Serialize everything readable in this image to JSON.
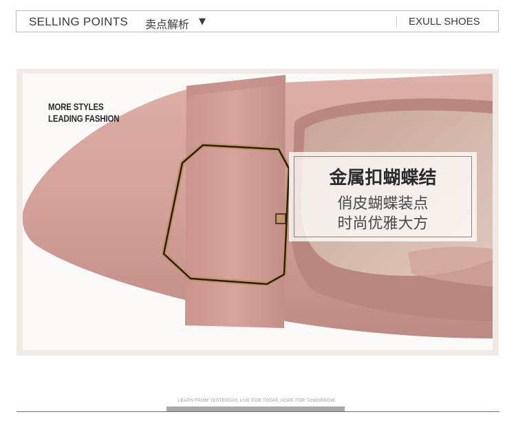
{
  "header": {
    "title": "SELLING POINTS",
    "title_cn": "卖点解析",
    "arrow": "▼",
    "brand": "EXULL SHOES"
  },
  "photo": {
    "slogan_line1": "MORE STYLES",
    "slogan_line2": "LEADING FASHION",
    "feature_title": "金属扣蝴蝶结",
    "feature_line1": "俏皮蝴蝶装点",
    "feature_line2": "时尚优雅大方"
  },
  "footer": {
    "tagline": "LEARN FROM YESTERDAY, LIVE FOR TODAY, HOPE FOR TOMORROW."
  },
  "colors": {
    "suede": "#d8a9a2",
    "buckle": "#b8895a",
    "frame": "#efe9e7"
  }
}
